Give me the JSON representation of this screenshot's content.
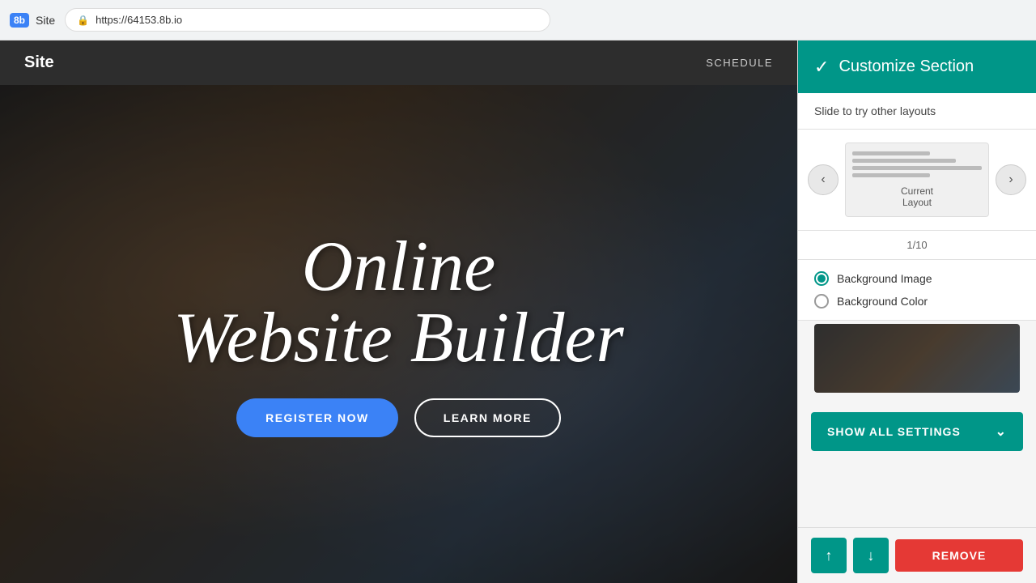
{
  "browser": {
    "logo_text": "8b",
    "site_label": "Site",
    "url": "https://64153.8b.io",
    "lock_icon": "🔒"
  },
  "site_nav": {
    "logo": "Site",
    "links": [
      "SCHEDULE"
    ]
  },
  "hero": {
    "title_line1": "Online",
    "title_line2": "Website Builder",
    "register_button": "REGISTER NOW",
    "learn_button": "LEARN MORE"
  },
  "panel": {
    "header_icon": "✓",
    "title": "Customize Section",
    "subtitle": "Slide to try other layouts",
    "pagination": "1/10",
    "layout_label": "Current\nLayout",
    "layout_label_line1": "Current",
    "layout_label_line2": "Layout",
    "bg_image_label": "Background Image",
    "bg_color_label": "Background Color",
    "show_settings_label": "SHOW ALL SETTINGS",
    "remove_label": "REMOVE",
    "prev_arrow": "‹",
    "next_arrow": "›",
    "up_arrow": "↑",
    "down_arrow": "↓",
    "chevron_down": "⌄"
  },
  "colors": {
    "teal": "#009688",
    "blue_btn": "#3b82f6",
    "red_btn": "#e53935"
  }
}
